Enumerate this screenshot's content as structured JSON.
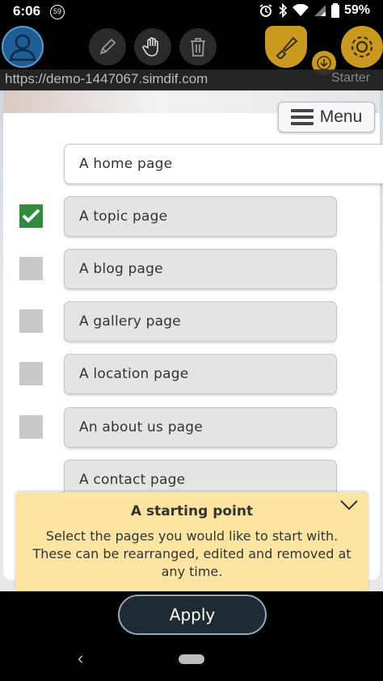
{
  "status_bar": {
    "time": "6:06",
    "notification_badge": "59",
    "battery_percent": "59%",
    "icons": [
      "alarm-icon",
      "bluetooth-icon",
      "wifi-icon",
      "signal-icon",
      "battery-icon"
    ]
  },
  "toolbar": {
    "tools": [
      "pencil-icon",
      "hand-icon",
      "trash-icon"
    ],
    "right_tools": [
      "brush-icon",
      "download-icon",
      "gear-icon"
    ],
    "starter_label": "Starter",
    "accent_color": "#c99a1e"
  },
  "url_bar": {
    "url": "https://demo-1447067.simdif.com"
  },
  "menu": {
    "label": "Menu"
  },
  "pages": [
    {
      "label": "A home page",
      "checked": null
    },
    {
      "label": "A topic page",
      "checked": true
    },
    {
      "label": "A blog page",
      "checked": false
    },
    {
      "label": "A gallery page",
      "checked": false
    },
    {
      "label": "A location page",
      "checked": false
    },
    {
      "label": "An about us page",
      "checked": false
    },
    {
      "label": "A contact page",
      "checked": false
    }
  ],
  "info_panel": {
    "title": "A starting point",
    "line1": "Select the pages you would like to start with.",
    "line2": "These can be rearranged, edited and removed at",
    "line3": "any time."
  },
  "actions": {
    "apply_label": "Apply"
  },
  "navigation": {
    "back_label": "‹"
  }
}
